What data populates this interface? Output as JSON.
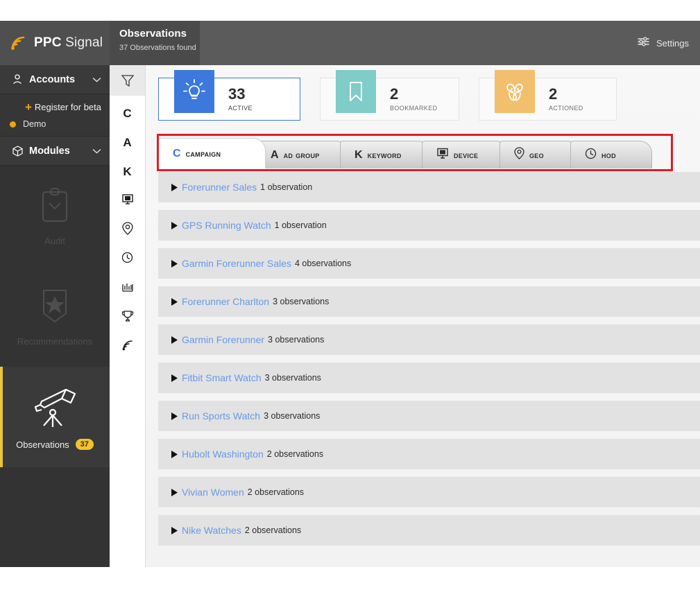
{
  "brand": {
    "name_bold": "PPC",
    "name_light": "Signal",
    "icon": "signal-icon"
  },
  "header": {
    "title": "Observations",
    "subtitle": "37 Observations found",
    "settings_label": "Settings",
    "settings_icon": "sliders-icon"
  },
  "sidebar": {
    "accounts": {
      "label": "Accounts",
      "icon": "user-icon",
      "chevron": "chevron-down-icon"
    },
    "register_label": "Register for beta",
    "register_icon": "plus-icon",
    "demo_label": "Demo",
    "modules": {
      "label": "Modules",
      "icon": "cube-icon",
      "chevron": "chevron-down-icon"
    },
    "nav": [
      {
        "label": "Audit",
        "icon": "clipboard-check-icon",
        "active": false
      },
      {
        "label": "Recommendations",
        "icon": "star-banner-icon",
        "active": false
      },
      {
        "label": "Observations",
        "icon": "telescope-icon",
        "active": true,
        "badge": "37"
      }
    ]
  },
  "rail": {
    "filter_icon": "filter-icon",
    "items": [
      {
        "label": "C",
        "icon": "campaign-letter-icon"
      },
      {
        "label": "A",
        "icon": "adgroup-letter-icon"
      },
      {
        "label": "K",
        "icon": "keyword-letter-icon"
      },
      {
        "label": "",
        "icon": "device-icon"
      },
      {
        "label": "",
        "icon": "geo-pin-icon"
      },
      {
        "label": "",
        "icon": "clock-icon"
      },
      {
        "label": "",
        "icon": "chart-icon"
      },
      {
        "label": "",
        "icon": "trophy-icon"
      },
      {
        "label": "",
        "icon": "signal-icon"
      }
    ]
  },
  "stats": [
    {
      "count": "33",
      "label": "Active",
      "icon": "lightbulb-icon",
      "color": "#3d78dc",
      "selected": true
    },
    {
      "count": "2",
      "label": "Bookmarked",
      "icon": "bookmark-icon",
      "color": "#7fccc8",
      "selected": false
    },
    {
      "count": "2",
      "label": "Actioned",
      "icon": "loop-arrows-icon",
      "color": "#f2bf6d",
      "selected": false
    }
  ],
  "tabs": [
    {
      "key": "C",
      "label": "Campaign",
      "icon": "",
      "selected": true
    },
    {
      "key": "A",
      "label": "Ad Group",
      "icon": "",
      "selected": false
    },
    {
      "key": "K",
      "label": "Keyword",
      "icon": "",
      "selected": false
    },
    {
      "key": "",
      "label": "Device",
      "icon": "device-icon",
      "selected": false
    },
    {
      "key": "",
      "label": "Geo",
      "icon": "geo-pin-icon",
      "selected": false
    },
    {
      "key": "",
      "label": "HoD",
      "icon": "clock-icon",
      "selected": false
    }
  ],
  "highlight_color": "#e31b23",
  "observations": [
    {
      "name": "Forerunner Sales",
      "count": "1 observation"
    },
    {
      "name": "GPS Running Watch",
      "count": "1 observation"
    },
    {
      "name": "Garmin Forerunner Sales",
      "count": "4 observations"
    },
    {
      "name": "Forerunner Charlton",
      "count": "3 observations"
    },
    {
      "name": "Garmin Forerunner",
      "count": "3 observations"
    },
    {
      "name": "Fitbit Smart Watch",
      "count": "3 observations"
    },
    {
      "name": "Run Sports Watch",
      "count": "3 observations"
    },
    {
      "name": "Hubolt Washington",
      "count": "2 observations"
    },
    {
      "name": "Vivian Women",
      "count": "2 observations"
    },
    {
      "name": "Nike Watches",
      "count": "2 observations"
    }
  ]
}
